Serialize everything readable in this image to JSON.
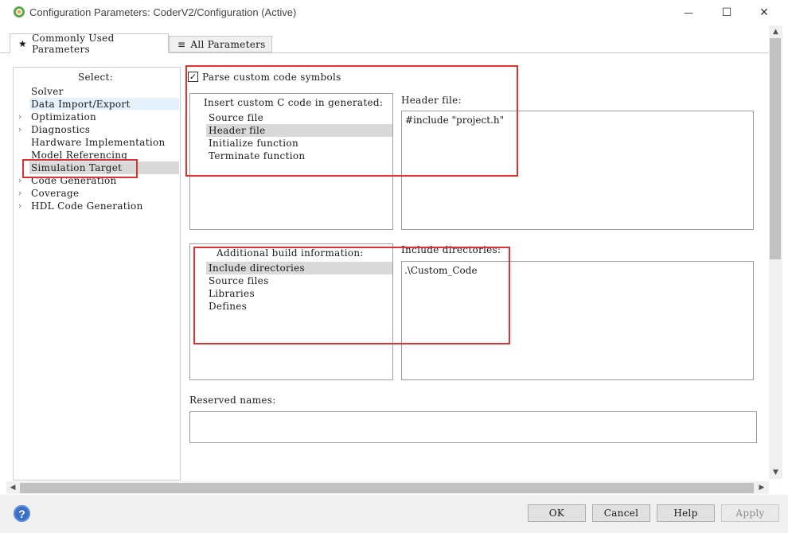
{
  "window": {
    "title": "Configuration Parameters: CoderV2/Configuration (Active)",
    "controls": {
      "minimize": "—",
      "maximize": "☐",
      "close": "✕"
    }
  },
  "tabs": [
    {
      "label": "Commonly Used Parameters",
      "icon": "star-icon",
      "glyph": "★",
      "active": true
    },
    {
      "label": "All Parameters",
      "icon": "list-icon",
      "glyph": "≡",
      "active": false
    }
  ],
  "sidebar": {
    "header": "Select:",
    "items": [
      {
        "label": "Solver",
        "expandable": false
      },
      {
        "label": "Data Import/Export",
        "expandable": false,
        "hover": true
      },
      {
        "label": "Optimization",
        "expandable": true
      },
      {
        "label": "Diagnostics",
        "expandable": true
      },
      {
        "label": "Hardware Implementation",
        "expandable": false
      },
      {
        "label": "Model Referencing",
        "expandable": false
      },
      {
        "label": "Simulation Target",
        "expandable": false,
        "selected": true
      },
      {
        "label": "Code Generation",
        "expandable": true
      },
      {
        "label": "Coverage",
        "expandable": true
      },
      {
        "label": "HDL Code Generation",
        "expandable": true
      }
    ]
  },
  "main": {
    "parse_checkbox": {
      "label": "Parse custom code symbols",
      "checked": true,
      "glyph": "✓"
    },
    "insert_code": {
      "title": "Insert custom C code in generated:",
      "items": [
        "Source file",
        "Header file",
        "Initialize function",
        "Terminate function"
      ],
      "selected": "Header file"
    },
    "header_file": {
      "label": "Header file:",
      "value": "#include \"project.h\""
    },
    "build_info": {
      "title": "Additional build information:",
      "items": [
        "Include directories",
        "Source files",
        "Libraries",
        "Defines"
      ],
      "selected": "Include directories"
    },
    "include_dirs": {
      "label": "Include directories:",
      "value": ".\\Custom_Code"
    },
    "reserved_names": {
      "label": "Reserved names:",
      "value": ""
    }
  },
  "buttons": {
    "ok": "OK",
    "cancel": "Cancel",
    "help": "Help",
    "apply": "Apply",
    "help_icon": "?"
  },
  "scroll_arrows": {
    "up": "▲",
    "down": "▼",
    "left": "◀",
    "right": "▶",
    "chevron": "›"
  },
  "colors": {
    "annotation_red": "#e03131",
    "selection_gray": "#d9d9d9",
    "hover_blue": "#e5f1fb",
    "help_blue": "#3a6fc4"
  }
}
